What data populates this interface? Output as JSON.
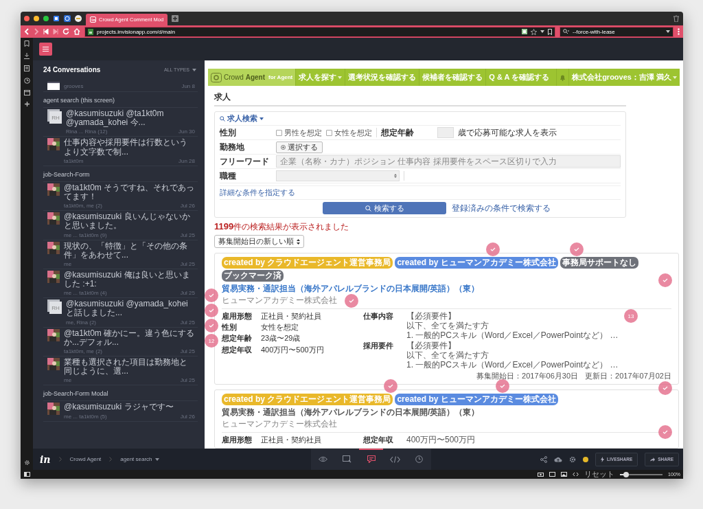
{
  "browser": {
    "tab_title": "Crowd Agent Comment Mod",
    "url": "projects.invisionapp.com/d/main",
    "search": "--force-with-lease"
  },
  "sidebar": {
    "title": "24 Conversations",
    "filter": "ALL TYPES",
    "groups": [
      {
        "items": [
          {
            "kind": "screen",
            "people": "grooves",
            "date": "Jun 8"
          }
        ]
      },
      {
        "title": "agent search (this screen)",
        "items": [
          {
            "kind": "initials",
            "initials": "RH",
            "text": "@kasumisuzuki  @ta1kt0m  @yamada_kohei  今...",
            "people": "Rina ... Rina (12)",
            "date": "Jun 30"
          },
          {
            "kind": "photo",
            "text": "仕事内容や採用要件は行数というより文字数で制...",
            "people": "ta1kt0m",
            "date": "Jun 28"
          }
        ]
      },
      {
        "title": "job-Search-Form",
        "items": [
          {
            "kind": "photo",
            "text": "@ta1kt0m  そうですね、それであってます！",
            "people": "ta1kt0m, me (2)",
            "date": "Jul 26"
          },
          {
            "kind": "photo",
            "text": "@kasumisuzuki  良いんじゃないかと思いました。",
            "people": "me ... ta1kt0m (9)",
            "date": "Jul 25"
          },
          {
            "kind": "photo",
            "text": "現状の、「特徴」と「その他の条件」をあわせて...",
            "people": "me",
            "date": "Jul 25"
          },
          {
            "kind": "photo",
            "text": "@kasumisuzuki  俺は良いと思いました :+1:",
            "people": "me ... ta1kt0m (4)",
            "date": "Jul 25"
          },
          {
            "kind": "initials",
            "initials": "RH",
            "text": "@kasumisuzuki  @yamada_kohei  と話しました...",
            "people": "me, Rina (2)",
            "date": "Jul 25"
          },
          {
            "kind": "photo",
            "text": "@ta1kt0m  確かにー。違う色にするか...デフォル...",
            "people": "ta1kt0m, me (2)",
            "date": "Jul 25"
          },
          {
            "kind": "photo",
            "text": "業種も選択された項目は勤務地と同じように、選...",
            "people": "me",
            "date": "Jul 25"
          }
        ]
      },
      {
        "title": "job-Search-Form Modal",
        "items": [
          {
            "kind": "photo",
            "text": "@kasumisuzuki  ラジャです〜",
            "people": "me ... ta1kt0m (5)",
            "date": "Jul 26"
          }
        ]
      }
    ]
  },
  "screen": {
    "logo": "Crowd **Agent**",
    "logo_sub": "for Agent",
    "nav": [
      {
        "label": "求人を探す",
        "dropdown": true
      },
      {
        "label": "選考状況を確認する",
        "dropdown": false
      },
      {
        "label": "候補者を確認する",
        "dropdown": false
      },
      {
        "label": "Q & A を確認する",
        "dropdown": false
      }
    ],
    "user": "株式会社grooves：吉澤 満久",
    "page_title": "求人",
    "search": {
      "toggle": "求人検索",
      "gender_label": "性別",
      "genders": [
        {
          "label": "男性を想定",
          "checked": false
        },
        {
          "label": "女性を想定",
          "checked": false
        }
      ],
      "age_label": "想定年齢",
      "age_hint": "歳で応募可能な求人を表示",
      "location_label": "勤務地",
      "location_button": "選択する",
      "keyword_label": "フリーワード",
      "keyword_placeholder": "企業（名称・カナ）ポジション 仕事内容 採用要件をスペース区切りで入力",
      "job_type_label": "職種",
      "detail_link": "詳細な条件を指定する",
      "submit": "検索する",
      "saved_link": "登録済みの条件で検索する"
    },
    "result_count": "**1199**件の検索結果が表示されました",
    "sort": "募集開始日の新しい順",
    "jobs": [
      {
        "active": true,
        "tags": [
          {
            "text": "created by クラウドエージェント運営事務局",
            "color": "#e9b82a"
          },
          {
            "text": "created by ヒューマンアカデミー株式会社",
            "color": "#5a8be0"
          },
          {
            "text": "事務局サポートなし",
            "color": "#6e7179"
          },
          {
            "text": "ブックマーク済",
            "color": "#6e7179"
          }
        ],
        "title": "貿易実務・通訳担当（海外アパレルブランドの日本展開/英語）（東）",
        "company": "ヒューマンアカデミー株式会社",
        "left": [
          {
            "label": "雇用形態",
            "value": "正社員・契約社員"
          },
          {
            "label": "性別",
            "value": "女性を想定"
          },
          {
            "label": "想定年齢",
            "value": "23歳〜29歳"
          },
          {
            "label": "想定年収",
            "value": "400万円〜500万円"
          }
        ],
        "right": [
          {
            "label": "仕事内容",
            "lines": [
              "【必須要件】",
              "以下、全てを満たす方",
              "1. 一般的PCスキル（Word／Excel／PowerPointなど） …"
            ]
          },
          {
            "label": "採用要件",
            "lines": [
              "【必須要件】",
              "以下、全てを満たす方",
              "1. 一般的PCスキル（Word／Excel／PowerPointなど） …"
            ]
          }
        ],
        "dates": [
          "募集開始日：2017年06月30日",
          "更新日：2017年07月02日"
        ]
      },
      {
        "active": false,
        "tags": [
          {
            "text": "created by クラウドエージェント運営事務局",
            "color": "#e9b82a"
          },
          {
            "text": "created by ヒューマンアカデミー株式会社",
            "color": "#5a8be0"
          }
        ],
        "title": "貿易実務・通訳担当（海外アパレルブランドの日本展開/英語）（東）",
        "company": "ヒューマンアカデミー株式会社",
        "left": [
          {
            "label": "雇用形態",
            "value": "正社員・契約社員"
          }
        ],
        "right": [
          {
            "label": "想定年収",
            "lines": [
              "400万円〜500万円"
            ]
          }
        ]
      }
    ],
    "pins": [
      {
        "kind": "check"
      },
      {
        "kind": "check"
      },
      {
        "kind": "check"
      },
      {
        "kind": "check"
      },
      {
        "kind": "check"
      },
      {
        "kind": "check"
      },
      {
        "kind": "check"
      },
      {
        "kind": "number",
        "label": "12"
      },
      {
        "kind": "number",
        "label": "13"
      },
      {
        "kind": "check"
      },
      {
        "kind": "check"
      },
      {
        "kind": "check"
      },
      {
        "kind": "check"
      }
    ]
  },
  "bottom": {
    "logo": "in",
    "breadcrumbs": [
      "Crowd Agent",
      "agent search"
    ],
    "tools": [
      {
        "kind": "preview",
        "selected": false
      },
      {
        "kind": "build",
        "selected": false
      },
      {
        "kind": "comment",
        "selected": true
      },
      {
        "kind": "inspect",
        "selected": false
      },
      {
        "kind": "history",
        "selected": false
      }
    ],
    "liveshare": "LIVESHARE",
    "share": "SHARE"
  },
  "status": {
    "reset": "リセット",
    "zoom": {
      "level": 0.15
    },
    "zoom_text": "100%"
  }
}
